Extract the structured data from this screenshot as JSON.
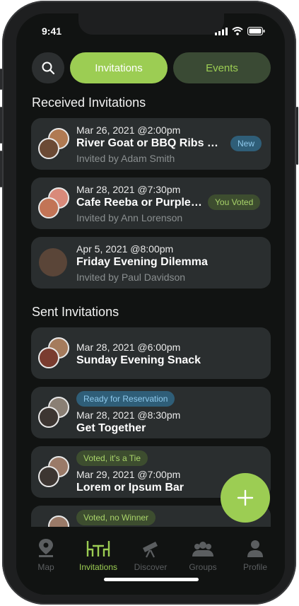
{
  "status_bar": {
    "time": "9:41"
  },
  "tabs": {
    "invitations": "Invitations",
    "events": "Events"
  },
  "received": {
    "title": "Received Invitations",
    "items": [
      {
        "date": "Mar 26, 2021 @2:00pm",
        "title": "River Goat or BBQ Ribs & C...",
        "sub": "Invited by Adam Smith",
        "badge": "New"
      },
      {
        "date": "Mar 28, 2021 @7:30pm",
        "title": "Cafe Reeba or Purple P...",
        "sub": "Invited by Ann Lorenson",
        "badge": "You Voted"
      },
      {
        "date": "Apr 5, 2021 @8:00pm",
        "title": "Friday Evening Dilemma",
        "sub": "Invited by Paul Davidson",
        "badge": ""
      }
    ]
  },
  "sent": {
    "title": "Sent Invitations",
    "items": [
      {
        "badge": "",
        "date": "Mar 28, 2021 @6:00pm",
        "title": "Sunday Evening Snack"
      },
      {
        "badge": "Ready for Reservation",
        "date": "Mar 28, 2021 @8:30pm",
        "title": "Get Together"
      },
      {
        "badge": "Voted, it's a Tie",
        "date": "Mar 29, 2021 @7:00pm",
        "title": "Lorem or Ipsum Bar"
      },
      {
        "badge": "Voted, no Winner",
        "date": "",
        "title": ""
      }
    ]
  },
  "tabbar": {
    "items": [
      {
        "label": "Map",
        "icon": "map-pin-icon"
      },
      {
        "label": "Invitations",
        "icon": "table-icon"
      },
      {
        "label": "Discover",
        "icon": "telescope-icon"
      },
      {
        "label": "Groups",
        "icon": "group-icon"
      },
      {
        "label": "Profile",
        "icon": "person-icon"
      }
    ]
  },
  "colors": {
    "accent": "#9ccd53",
    "background": "#111312",
    "card": "#2a2e2f",
    "badge_blue": "#2f5e78"
  }
}
